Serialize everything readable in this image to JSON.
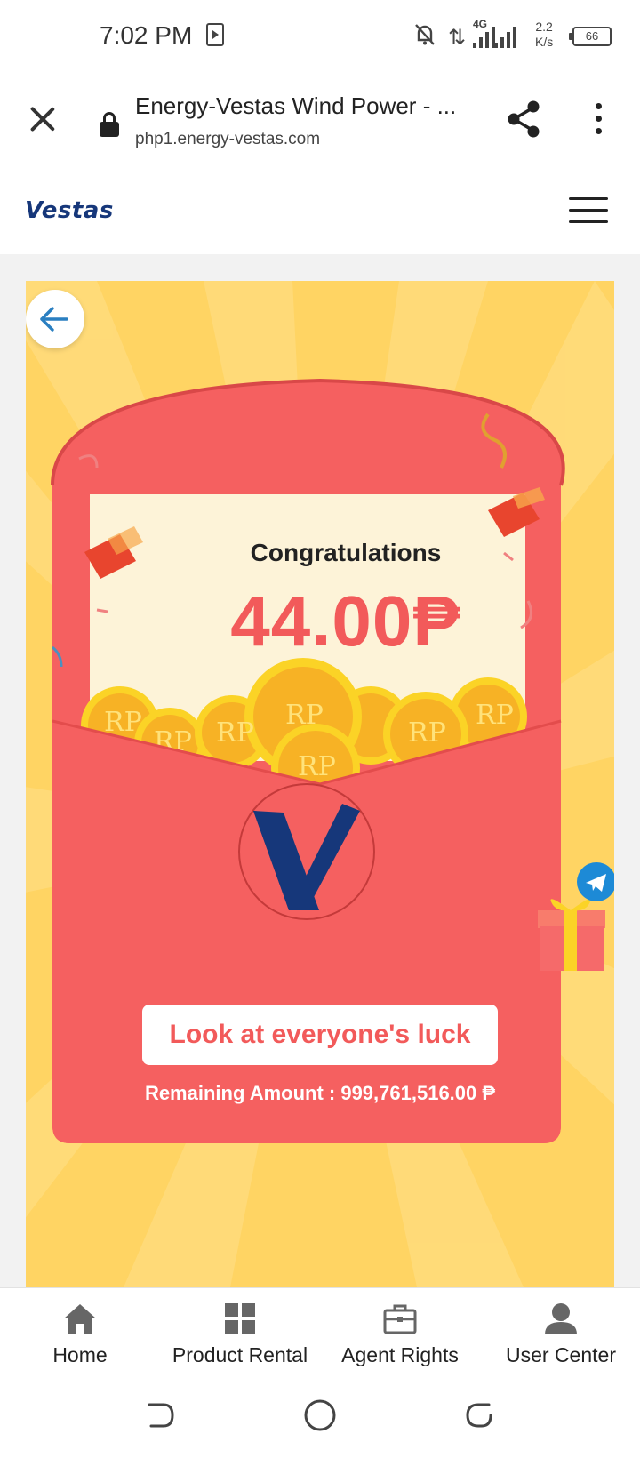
{
  "status_bar": {
    "time": "7:02 PM",
    "network": "4G",
    "speed_value": "2.2",
    "speed_unit": "K/s",
    "battery": "66"
  },
  "browser": {
    "title": "Energy-Vestas Wind Power - ...",
    "url": "php1.energy-vestas.com"
  },
  "site": {
    "logo_text": "Vestas"
  },
  "envelope": {
    "congrats": "Congratulations",
    "amount": "44.00₱",
    "coin_mark": "RP",
    "button_label": "Look at everyone's luck",
    "remaining_text": "Remaining Amount : 999,761,516.00 ₱"
  },
  "bottom_nav": {
    "items": [
      {
        "label": "Home",
        "icon": "home-icon"
      },
      {
        "label": "Product Rental",
        "icon": "grid-icon"
      },
      {
        "label": "Agent Rights",
        "icon": "briefcase-icon"
      },
      {
        "label": "User Center",
        "icon": "user-icon"
      }
    ]
  },
  "colors": {
    "envelope_red": "#f56060",
    "amount_red": "#f25a5a",
    "background_yellow": "#ffd463",
    "logo_blue": "#16377a",
    "telegram_blue": "#1d8ad6"
  }
}
